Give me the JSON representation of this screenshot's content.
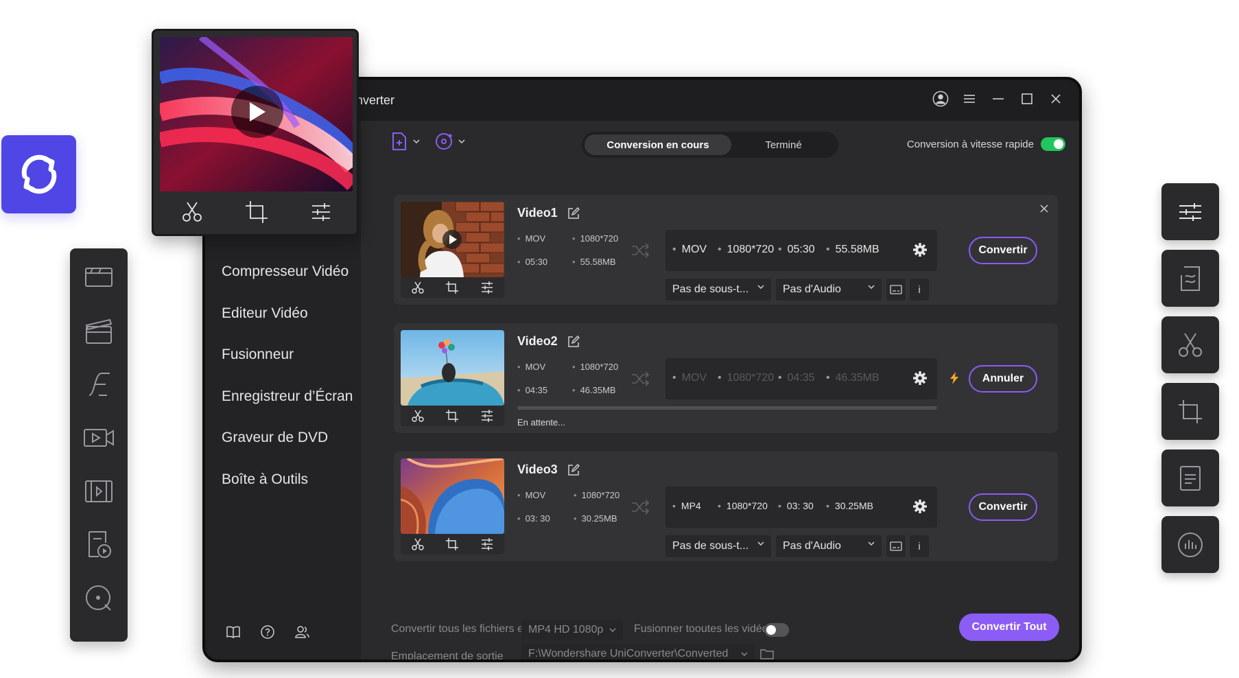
{
  "app": {
    "title_partial": "nverter"
  },
  "tabs": {
    "active": "Conversion en cours",
    "inactive": "Terminé"
  },
  "fast_conversion": {
    "label": "Conversion à vitesse rapide",
    "enabled": true
  },
  "sidebar": {
    "items": [
      {
        "label": "Compresseur Vidéo"
      },
      {
        "label": "Editeur Vidéo"
      },
      {
        "label": "Fusionneur"
      },
      {
        "label": "Enregistreur d’Écran"
      },
      {
        "label": "Graveur de DVD"
      },
      {
        "label": "Boîte à Outils"
      }
    ]
  },
  "files": [
    {
      "name": "Video1",
      "source": {
        "format": "MOV",
        "resolution": "1080*720",
        "duration": "05:30",
        "size": "55.58MB"
      },
      "output": {
        "format": "MOV",
        "resolution": "1080*720",
        "duration": "05:30",
        "size": "55.58MB"
      },
      "subtitle": "Pas de sous-t...",
      "audio": "Pas d'Audio",
      "action": "Convertir"
    },
    {
      "name": "Video2",
      "source": {
        "format": "MOV",
        "resolution": "1080*720",
        "duration": "04:35",
        "size": "46.35MB"
      },
      "output": {
        "format": "MOV",
        "resolution": "1080*720",
        "duration": "04:35",
        "size": "46.35MB"
      },
      "status": "En attente...",
      "action": "Annuler"
    },
    {
      "name": "Video3",
      "source": {
        "format": "MOV",
        "resolution": "1080*720",
        "duration": "03: 30",
        "size": "30.25MB"
      },
      "output": {
        "format": "MP4",
        "resolution": "1080*720",
        "duration": "03: 30",
        "size": "30.25MB"
      },
      "subtitle": "Pas de sous-t...",
      "audio": "Pas d'Audio",
      "action": "Convertir"
    }
  ],
  "info_glyph": "i",
  "bottom": {
    "convert_label": "Convertir tous les fichiers en:",
    "convert_value": "MP4 HD 1080p",
    "merge_label": "Fusionner tooutes les vidéos:",
    "merge_enabled": false,
    "output_label": "Emplacement de sortie",
    "output_path": "F:\\Wondershare UniConverter\\Converted",
    "convert_all": "Convertir Tout"
  },
  "colors": {
    "accent": "#8b5cf6",
    "logo": "#4f46e5",
    "toggle_on": "#22c55e",
    "bolt": "#f5a623"
  },
  "icons": {
    "left_bar": [
      "video-converter-icon",
      "video-editor-icon",
      "merger-icon",
      "screen-recorder-icon",
      "compress-icon",
      "dvd-burner-icon",
      "player-icon"
    ],
    "right_tiles": [
      "settings-sliders-icon",
      "watermark-icon",
      "scissors-icon",
      "crop-icon",
      "subtitle-icon",
      "audio-icon"
    ]
  }
}
